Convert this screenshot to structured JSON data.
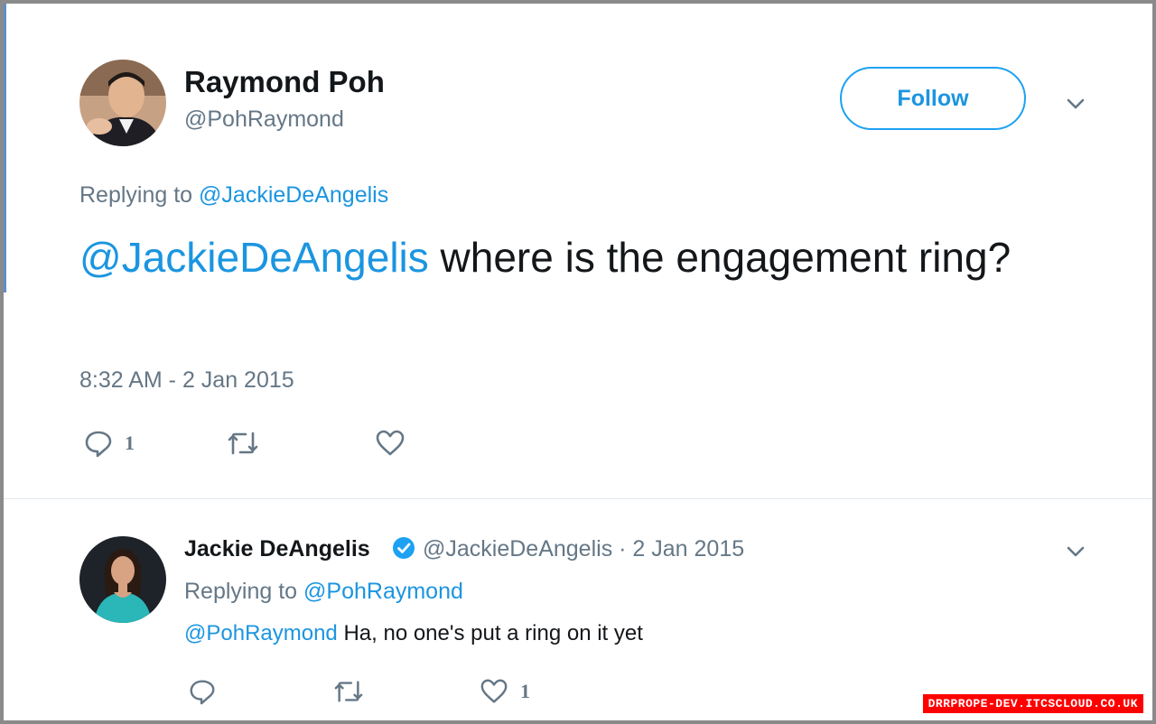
{
  "tweet": {
    "author_name": "Raymond Poh",
    "author_handle": "@PohRaymond",
    "follow_label": "Follow",
    "replying_prefix": "Replying to",
    "replying_to": "@JackieDeAngelis",
    "text_mention": "@JackieDeAngelis",
    "text_body": " where is the engagement ring?",
    "timestamp": "8:32 AM - 2 Jan 2015",
    "reply_count": "1",
    "retweet_count": "",
    "like_count": ""
  },
  "reply": {
    "author_name": "Jackie DeAngelis",
    "verified": true,
    "author_handle": "@JackieDeAngelis",
    "date": "· 2 Jan 2015",
    "replying_prefix": "Replying to",
    "replying_to": "@PohRaymond",
    "text_mention": "@PohRaymond",
    "text_body": " Ha, no one's put a ring on it yet",
    "reply_count": "",
    "retweet_count": "",
    "like_count": "1"
  },
  "watermark": "DRRPROPE-DEV.ITCSCLOUD.CO.UK",
  "colors": {
    "link": "#1b95e0",
    "muted": "#657786",
    "text": "#14171a",
    "verified": "#1da1f2",
    "watermark_bg": "#ff0000"
  },
  "icons": [
    "reply-icon",
    "retweet-icon",
    "like-icon",
    "chevron-down-icon",
    "verified-badge-icon"
  ]
}
